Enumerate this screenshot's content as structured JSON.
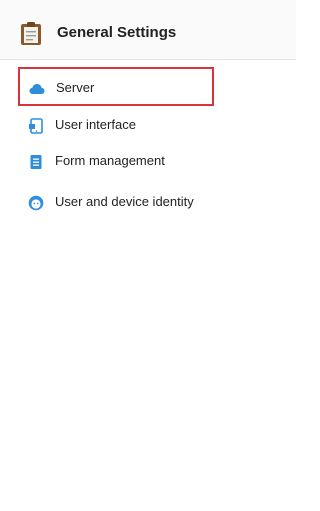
{
  "header": {
    "title": "General Settings",
    "icon": "clipboard-icon"
  },
  "menu": {
    "items": [
      {
        "label": "Server",
        "icon": "cloud-icon",
        "selected": true
      },
      {
        "label": "User interface",
        "icon": "tablet-icon",
        "selected": false
      },
      {
        "label": "Form management",
        "icon": "document-icon",
        "selected": false
      },
      {
        "label": "User and device identity",
        "icon": "face-icon",
        "selected": false
      }
    ]
  },
  "colors": {
    "accent": "#2f8ddb",
    "highlight_border": "#d9343d",
    "clipboard_board": "#8a5a2b"
  }
}
